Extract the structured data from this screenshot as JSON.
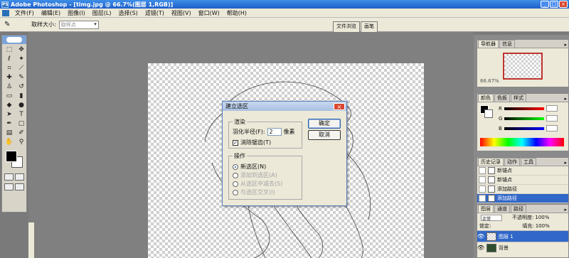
{
  "window": {
    "app_logo": "PS",
    "title": "Adobe Photoshop - [timg.jpg @ 66.7%(图层 1,RGB)]",
    "buttons": [
      "_",
      "□",
      "×"
    ]
  },
  "menubar": {
    "items": [
      "文件(F)",
      "编辑(E)",
      "图像(I)",
      "图层(L)",
      "选择(S)",
      "滤镜(T)",
      "视图(V)",
      "窗口(W)",
      "帮助(H)"
    ]
  },
  "options": {
    "tool_icon": "eyedropper-icon",
    "sample_label": "取样大小:",
    "sample_value": "取样点",
    "well_tabs": [
      "文件浏览",
      "画笔"
    ]
  },
  "dialog": {
    "title": "建立选区",
    "close": "×",
    "render_group": "渲染",
    "feather_label": "羽化半径(F):",
    "feather_value": "2",
    "feather_unit": "像素",
    "antialias_label": "消除锯齿(T)",
    "antialias_checked": "✓",
    "operation_group": "操作",
    "operations": [
      "新选区(N)",
      "添加到选区(A)",
      "从选区中减去(S)",
      "与选区交叉(I)"
    ],
    "ok": "确定",
    "cancel": "取消"
  },
  "panels": {
    "navigator": {
      "tabs": [
        "导航器",
        "信息"
      ],
      "zoom": "66.67%"
    },
    "color": {
      "tabs": [
        "颜色",
        "色板",
        "样式"
      ],
      "channels": [
        "R",
        "G",
        "B"
      ]
    },
    "history": {
      "tabs": [
        "历史记录",
        "动作",
        "工具"
      ],
      "items": [
        "新锚点",
        "新锚点",
        "添加路径",
        "添加路径"
      ]
    },
    "layers": {
      "tabs": [
        "图层",
        "通道",
        "路径"
      ],
      "blend_mode": "正常",
      "opacity_label": "不透明度:",
      "opacity": "100%",
      "lock_label": "锁定:",
      "fill_label": "填充:",
      "fill": "100%",
      "items": [
        "图层 1",
        "背景"
      ]
    }
  }
}
